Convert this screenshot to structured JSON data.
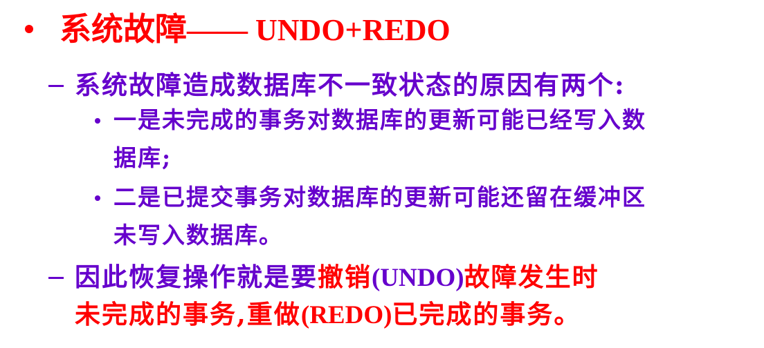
{
  "colors": {
    "red": "#ff0000",
    "purple": "#6600cc"
  },
  "heading": {
    "bullet": "•",
    "title_cn": "系统故障",
    "title_rest": "—— UNDO+REDO"
  },
  "item1": {
    "dash": "–",
    "text": "系统故障造成数据库不一致状态的原因有两个:",
    "sub1_line1": "一是未完成的事务对数据库的更新可能已经写入数",
    "sub1_line2": "据库;",
    "sub2_line1": "二是已提交事务对数据库的更新可能还留在缓冲区",
    "sub2_line2": "未写入数据库。"
  },
  "item2": {
    "dash": "–",
    "part1": "因此恢复操作就是要",
    "part2": "撤销",
    "part3": "(UNDO)",
    "part4": "故障发生时",
    "line2_part1": "未完成的事务,重做",
    "line2_part2": "(REDO)",
    "line2_part3": "已完成的事务。"
  }
}
